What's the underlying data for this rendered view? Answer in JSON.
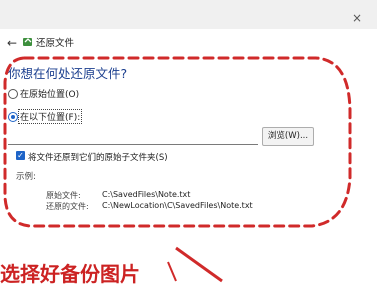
{
  "window": {
    "title": "还原文件",
    "close_glyph": "×",
    "back_glyph": "←"
  },
  "main": {
    "heading": "你想在何处还原文件?",
    "options": [
      {
        "label": "在原始位置(O)",
        "selected": false
      },
      {
        "label": "在以下位置(F):",
        "selected": true
      }
    ],
    "location_value": "",
    "browse_label": "浏览(W)...",
    "keep_structure": {
      "label": "将文件还原到它们的原始子文件夹(S)",
      "checked": true
    },
    "example": {
      "label": "示例:",
      "rows": [
        {
          "key": "原始文件:",
          "value": "C:\\SavedFiles\\Note.txt"
        },
        {
          "key": "还原的文件:",
          "value": "C:\\NewLocation\\C\\SavedFiles\\Note.txt"
        }
      ]
    }
  },
  "annotation": {
    "caption": "选择好备份图片",
    "color": "#cc2222"
  },
  "icons": [
    "close-icon",
    "back-arrow-icon",
    "restore-file-icon"
  ]
}
